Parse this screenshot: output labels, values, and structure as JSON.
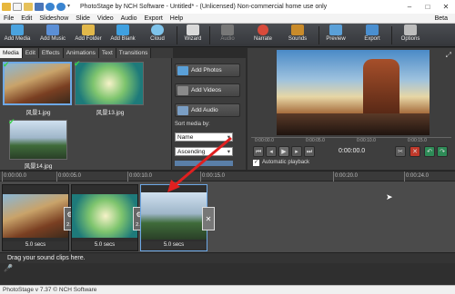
{
  "window": {
    "title": "PhotoStage by NCH Software - Untitled* - (Unlicensed) Non-commercial home use only",
    "controls": [
      "–",
      "□",
      "✕"
    ]
  },
  "menu": {
    "items": [
      "File",
      "Edit",
      "Slideshow",
      "Slide",
      "Video",
      "Audio",
      "Export",
      "Help"
    ],
    "beta": "Beta"
  },
  "toolbar": {
    "buttons": [
      {
        "label": "Add Media",
        "icon": "add-media-icon",
        "color": "#4aa3df"
      },
      {
        "label": "Add Music",
        "icon": "add-music-icon",
        "color": "#5b8fd6"
      },
      {
        "label": "Add Folder",
        "icon": "add-folder-icon",
        "color": "#e2b84a"
      },
      {
        "label": "Add Blank",
        "icon": "add-blank-icon",
        "color": "#3fa0e0"
      },
      {
        "label": "Cloud",
        "icon": "cloud-icon",
        "color": "#7ec3ea"
      },
      {
        "label": "Wizard",
        "icon": "wizard-icon",
        "color": "#d9d9d9"
      },
      {
        "label": "Audio",
        "icon": "audio-icon",
        "color": "#777777"
      },
      {
        "label": "Narrate",
        "icon": "narrate-icon",
        "color": "#d84a3a"
      },
      {
        "label": "Sounds",
        "icon": "sounds-icon",
        "color": "#c98b2a"
      },
      {
        "label": "Preview",
        "icon": "preview-icon",
        "color": "#5aa0d8"
      },
      {
        "label": "Export",
        "icon": "export-icon",
        "color": "#4a8fd0"
      },
      {
        "label": "Options",
        "icon": "options-icon",
        "color": "#bdbdbd"
      }
    ]
  },
  "tabs": [
    "Media",
    "Edit",
    "Effects",
    "Animations",
    "Text",
    "Transitions"
  ],
  "media": {
    "items": [
      {
        "label": "风景1.jpg",
        "checked": true
      },
      {
        "label": "风景13.jpg",
        "checked": true
      },
      {
        "label": "风景14.jpg",
        "checked": true
      }
    ]
  },
  "sidepanel": {
    "buttons": [
      "Add Photos",
      "Add Videos",
      "Add Audio"
    ],
    "sort_label": "Sort media by:",
    "sort_field": "Name",
    "sort_order": "Ascending"
  },
  "preview": {
    "time": "0:00:00.0",
    "auto_playback": "Automatic playback",
    "ruler": [
      "0:00:00.0",
      "0:00:05.0",
      "0:00:10.0",
      "0:00:15.0"
    ]
  },
  "timeline": {
    "ruler": [
      "0:00:00.0",
      "0:00:05.0",
      "0:00:10.0",
      "0:00:15.0",
      "0:00:20.0",
      "0:00:24.0"
    ],
    "clips": [
      {
        "duration": "5.0 secs"
      },
      {
        "duration": "5.0 secs"
      },
      {
        "duration": "5.0 secs"
      }
    ],
    "transition_label": "2.0"
  },
  "soundtrack": {
    "hint": "Drag your sound clips here."
  },
  "status": {
    "text": "PhotoStage v 7.37 © NCH Software"
  }
}
